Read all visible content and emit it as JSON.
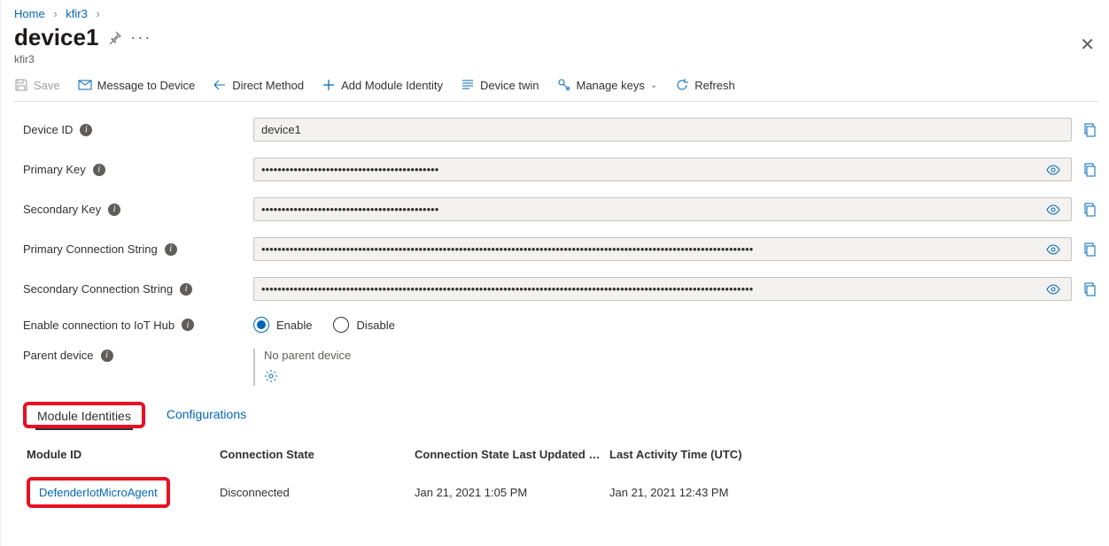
{
  "breadcrumb": {
    "home": "Home",
    "parent": "kfir3"
  },
  "title": "device1",
  "subtitle": "kfir3",
  "toolbar": {
    "save": "Save",
    "message": "Message to Device",
    "direct_method": "Direct Method",
    "add_module": "Add Module Identity",
    "device_twin": "Device twin",
    "manage_keys": "Manage keys",
    "refresh": "Refresh"
  },
  "labels": {
    "device_id": "Device ID",
    "primary_key": "Primary Key",
    "secondary_key": "Secondary Key",
    "primary_cs": "Primary Connection String",
    "secondary_cs": "Secondary Connection String",
    "enable_conn": "Enable connection to IoT Hub",
    "parent_device": "Parent device"
  },
  "values": {
    "device_id": "device1",
    "primary_key": "••••••••••••••••••••••••••••••••••••••••••••",
    "secondary_key": "••••••••••••••••••••••••••••••••••••••••••••",
    "primary_cs": "••••••••••••••••••••••••••••••••••••••••••••••••••••••••••••••••••••••••••••••••••••••••••••••••••••••••••••••••••••••••••",
    "secondary_cs": "••••••••••••••••••••••••••••••••••••••••••••••••••••••••••••••••••••••••••••••••••••••••••••••••••••••••••••••••••••••••••",
    "parent_device": "No parent device"
  },
  "radio": {
    "enable": "Enable",
    "disable": "Disable"
  },
  "tabs": {
    "module_identities": "Module Identities",
    "configurations": "Configurations"
  },
  "table": {
    "headers": {
      "module_id": "Module ID",
      "connection_state": "Connection State",
      "last_updated": "Connection State Last Updated …",
      "last_activity": "Last Activity Time (UTC)"
    },
    "rows": [
      {
        "module_id": "DefenderIotMicroAgent",
        "connection_state": "Disconnected",
        "last_updated": "Jan 21, 2021 1:05 PM",
        "last_activity": "Jan 21, 2021 12:43 PM"
      }
    ]
  }
}
